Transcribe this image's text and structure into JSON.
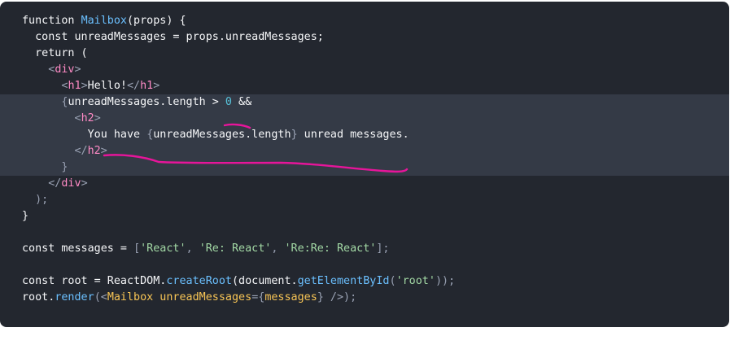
{
  "code": {
    "lines": [
      {
        "tokens": [
          {
            "t": "function ",
            "c": "tok-keyword"
          },
          {
            "t": "Mailbox",
            "c": "tok-fn"
          },
          {
            "t": "(props) {",
            "c": "tok-keyword"
          }
        ]
      },
      {
        "tokens": [
          {
            "t": "  const unreadMessages = props.unreadMessages;",
            "c": "tok-keyword"
          }
        ]
      },
      {
        "tokens": [
          {
            "t": "  return (",
            "c": "tok-keyword"
          }
        ]
      },
      {
        "tokens": [
          {
            "t": "    <",
            "c": "tok-punct"
          },
          {
            "t": "div",
            "c": "tok-tag"
          },
          {
            "t": ">",
            "c": "tok-punct"
          }
        ]
      },
      {
        "tokens": [
          {
            "t": "      <",
            "c": "tok-punct"
          },
          {
            "t": "h1",
            "c": "tok-tag"
          },
          {
            "t": ">",
            "c": "tok-punct"
          },
          {
            "t": "Hello!",
            "c": "tok-keyword"
          },
          {
            "t": "</",
            "c": "tok-punct"
          },
          {
            "t": "h1",
            "c": "tok-tag"
          },
          {
            "t": ">",
            "c": "tok-punct"
          }
        ]
      },
      {
        "hl": true,
        "tokens": [
          {
            "t": "      {",
            "c": "tok-punct"
          },
          {
            "t": "unreadMessages.length > ",
            "c": "tok-keyword"
          },
          {
            "t": "0",
            "c": "tok-num"
          },
          {
            "t": " &&",
            "c": "tok-keyword"
          }
        ]
      },
      {
        "hl": true,
        "tokens": [
          {
            "t": "        <",
            "c": "tok-punct"
          },
          {
            "t": "h2",
            "c": "tok-tag"
          },
          {
            "t": ">",
            "c": "tok-punct"
          }
        ]
      },
      {
        "hl": true,
        "tokens": [
          {
            "t": "          You have ",
            "c": "tok-keyword"
          },
          {
            "t": "{",
            "c": "tok-punct"
          },
          {
            "t": "unreadMessages.length",
            "c": "tok-keyword"
          },
          {
            "t": "}",
            "c": "tok-punct"
          },
          {
            "t": " unread messages.",
            "c": "tok-keyword"
          }
        ]
      },
      {
        "hl": true,
        "tokens": [
          {
            "t": "        </",
            "c": "tok-punct"
          },
          {
            "t": "h2",
            "c": "tok-tag"
          },
          {
            "t": ">",
            "c": "tok-punct"
          }
        ]
      },
      {
        "hl": true,
        "tokens": [
          {
            "t": "      }",
            "c": "tok-punct"
          }
        ]
      },
      {
        "tokens": [
          {
            "t": "    </",
            "c": "tok-punct"
          },
          {
            "t": "div",
            "c": "tok-tag"
          },
          {
            "t": ">",
            "c": "tok-punct"
          }
        ]
      },
      {
        "tokens": [
          {
            "t": "  );",
            "c": "tok-punct"
          }
        ]
      },
      {
        "tokens": [
          {
            "t": "}",
            "c": "tok-keyword"
          }
        ]
      },
      {
        "blank": true,
        "tokens": []
      },
      {
        "tokens": [
          {
            "t": "const messages = ",
            "c": "tok-keyword"
          },
          {
            "t": "[",
            "c": "tok-punct"
          },
          {
            "t": "'React'",
            "c": "tok-str"
          },
          {
            "t": ", ",
            "c": "tok-punct"
          },
          {
            "t": "'Re: React'",
            "c": "tok-str"
          },
          {
            "t": ", ",
            "c": "tok-punct"
          },
          {
            "t": "'Re:Re: React'",
            "c": "tok-str"
          },
          {
            "t": "];",
            "c": "tok-punct"
          }
        ]
      },
      {
        "blank": true,
        "tokens": []
      },
      {
        "tokens": [
          {
            "t": "const root = ReactDOM.",
            "c": "tok-keyword"
          },
          {
            "t": "createRoot",
            "c": "tok-fn"
          },
          {
            "t": "(document.",
            "c": "tok-keyword"
          },
          {
            "t": "getElementById",
            "c": "tok-fn"
          },
          {
            "t": "(",
            "c": "tok-punct"
          },
          {
            "t": "'root'",
            "c": "tok-str"
          },
          {
            "t": "));",
            "c": "tok-punct"
          }
        ]
      },
      {
        "tokens": [
          {
            "t": "root.",
            "c": "tok-keyword"
          },
          {
            "t": "render",
            "c": "tok-fn"
          },
          {
            "t": "(<",
            "c": "tok-punct"
          },
          {
            "t": "Mailbox",
            "c": "tok-comp"
          },
          {
            "t": " unreadMessages",
            "c": "tok-attr"
          },
          {
            "t": "={",
            "c": "tok-punct"
          },
          {
            "t": "messages",
            "c": "tok-comp"
          },
          {
            "t": "} />);",
            "c": "tok-punct"
          }
        ]
      }
    ]
  },
  "colors": {
    "panel_bg": "#23272f",
    "highlight_bg": "#343a46",
    "annotation": "#e6159a"
  }
}
